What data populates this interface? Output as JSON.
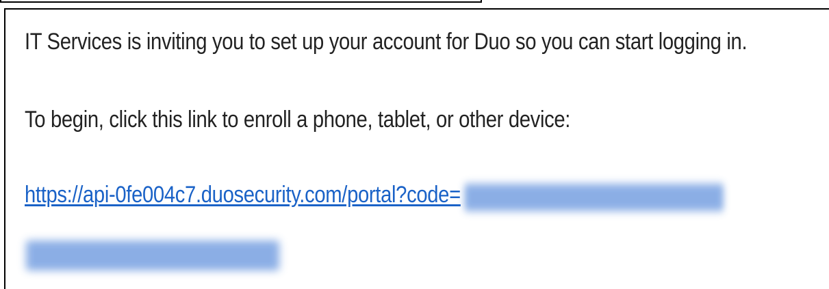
{
  "email": {
    "line1": "IT Services is inviting you to set up your account for Duo so you can start logging in.",
    "line2": "To begin, click this link to enroll a phone, tablet, or other device:",
    "link_text": "https://api-0fe004c7.duosecurity.com/portal?code=",
    "link_color": "#1a62c7"
  }
}
